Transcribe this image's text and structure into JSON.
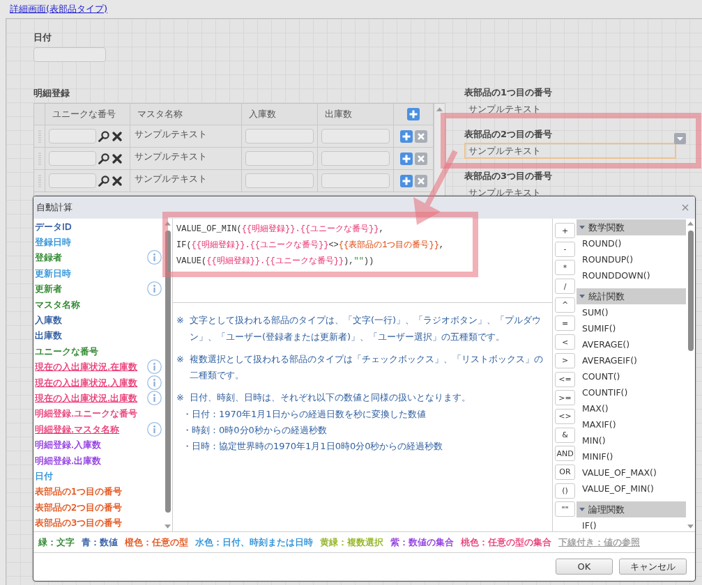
{
  "page_link": "詳細画面(表部品タイプ)",
  "date_field": {
    "label": "日付"
  },
  "detail_table": {
    "title": "明細登録",
    "columns": [
      "ユニークな番号",
      "マスタ名称",
      "入庫数",
      "出庫数"
    ],
    "rows": [
      {
        "master_name": "サンプルテキスト"
      },
      {
        "master_name": "サンプルテキスト"
      },
      {
        "master_name": "サンプルテキスト"
      }
    ]
  },
  "table_parts": [
    {
      "label": "表部品の1つ目の番号",
      "value": "サンプルテキスト",
      "selected": false
    },
    {
      "label": "表部品の2つ目の番号",
      "value": "サンプルテキスト",
      "selected": true
    },
    {
      "label": "表部品の3つ目の番号",
      "value": "サンプルテキスト",
      "selected": false
    }
  ],
  "dialog": {
    "title": "自動計算",
    "fields": [
      {
        "label": "データID",
        "color": "#1f4e99",
        "underlined": false,
        "info": false
      },
      {
        "label": "登録日時",
        "color": "#1f8ad6",
        "underlined": false,
        "info": false
      },
      {
        "label": "登録者",
        "color": "#1d7d1d",
        "underlined": false,
        "info": true
      },
      {
        "label": "更新日時",
        "color": "#1f8ad6",
        "underlined": false,
        "info": false
      },
      {
        "label": "更新者",
        "color": "#1d7d1d",
        "underlined": false,
        "info": true
      },
      {
        "label": "マスタ名称",
        "color": "#1d7d1d",
        "underlined": false,
        "info": false
      },
      {
        "label": "入庫数",
        "color": "#1f4e99",
        "underlined": false,
        "info": false
      },
      {
        "label": "出庫数",
        "color": "#1f4e99",
        "underlined": false,
        "info": false
      },
      {
        "label": "ユニークな番号",
        "color": "#1d7d1d",
        "underlined": false,
        "info": false
      },
      {
        "label": "現在の入出庫状況.在庫数",
        "color": "#e8336e",
        "underlined": true,
        "info": true
      },
      {
        "label": "現在の入出庫状況.入庫数",
        "color": "#e8336e",
        "underlined": true,
        "info": true
      },
      {
        "label": "現在の入出庫状況.出庫数",
        "color": "#e8336e",
        "underlined": true,
        "info": true
      },
      {
        "label": "明細登録.ユニークな番号",
        "color": "#e8336e",
        "underlined": false,
        "info": false
      },
      {
        "label": "明細登録.マスタ名称",
        "color": "#e8336e",
        "underlined": true,
        "info": true
      },
      {
        "label": "明細登録.入庫数",
        "color": "#8b2fe0",
        "underlined": false,
        "info": false
      },
      {
        "label": "明細登録.出庫数",
        "color": "#8b2fe0",
        "underlined": false,
        "info": false
      },
      {
        "label": "日付",
        "color": "#1f8ad6",
        "underlined": false,
        "info": false
      },
      {
        "label": "表部品の1つ目の番号",
        "color": "#e0480c",
        "underlined": false,
        "info": false
      },
      {
        "label": "表部品の2つ目の番号",
        "color": "#e0480c",
        "underlined": false,
        "info": false
      },
      {
        "label": "表部品の3つ目の番号",
        "color": "#e0480c",
        "underlined": false,
        "info": false
      }
    ],
    "formula": [
      {
        "tokens": [
          {
            "text": "VALUE_OF_MIN("
          },
          {
            "text": "{{明細登録}}.{{ユニークな番号}}",
            "color": "#e8336e"
          },
          {
            "text": ","
          }
        ]
      },
      {
        "tokens": [
          {
            "text": "IF("
          },
          {
            "text": "{{明細登録}}.{{ユニークな番号}}",
            "color": "#e8336e"
          },
          {
            "text": "<>"
          },
          {
            "text": "{{表部品の1つ目の番号}}",
            "color": "#e0480c"
          },
          {
            "text": ","
          }
        ]
      },
      {
        "tokens": [
          {
            "text": "VALUE("
          },
          {
            "text": "{{明細登録}}.{{ユニークな番号}}",
            "color": "#e8336e"
          },
          {
            "text": "),"
          },
          {
            "text": "\"\"",
            "color": "#3a9a3a"
          },
          {
            "text": "))"
          }
        ]
      }
    ],
    "notes": [
      {
        "mark": "※",
        "text": "文字として扱われる部品のタイプは、「文字(一行)」、「ラジオボタン」、「プルダウン」、「ユーザー(登録者または更新者)」、「ユーザー選択」の五種類です。"
      },
      {
        "mark": "※",
        "text": "複数選択として扱われる部品のタイプは「チェックボックス」、「リストボックス」の二種類です。"
      },
      {
        "mark": "※",
        "text": "日付、時刻、日時は、それぞれ以下の数値と同様の扱いとなります。",
        "items": [
          "・日付：1970年1月1日からの経過日数を秒に変換した数値",
          "・時刻：0時0分0秒からの経過秒数",
          "・日時：協定世界時の1970年1月1日0時0分0秒からの経過秒数"
        ]
      }
    ],
    "operators": [
      "+",
      "-",
      "*",
      "/",
      "^",
      "=",
      "<",
      ">",
      "<=",
      ">=",
      "<>",
      "&",
      "AND",
      "OR",
      "()",
      "\"\""
    ],
    "function_groups": [
      {
        "title": "数学関数",
        "expanded": true,
        "items": [
          "ROUND()",
          "ROUNDUP()",
          "ROUNDDOWN()"
        ]
      },
      {
        "title": "統計関数",
        "expanded": true,
        "items": [
          "SUM()",
          "SUMIF()",
          "AVERAGE()",
          "AVERAGEIF()",
          "COUNT()",
          "COUNTIF()",
          "MAX()",
          "MAXIF()",
          "MIN()",
          "MINIF()",
          "VALUE_OF_MAX()",
          "VALUE_OF_MIN()"
        ]
      },
      {
        "title": "論理関数",
        "expanded": true,
        "items": [
          "IF()"
        ]
      }
    ],
    "legend": [
      {
        "text": "緑：文字",
        "color": "#1d7d1d",
        "underlined": false
      },
      {
        "text": "青：数値",
        "color": "#1f4e99",
        "underlined": false
      },
      {
        "text": "橙色：任意の型",
        "color": "#e0480c",
        "underlined": false
      },
      {
        "text": "水色：日付、時刻または日時",
        "color": "#1f8ad6",
        "underlined": false
      },
      {
        "text": "黄緑：複数選択",
        "color": "#8aae12",
        "underlined": false
      },
      {
        "text": "紫：数値の集合",
        "color": "#8b2fe0",
        "underlined": false
      },
      {
        "text": "桃色：任意の型の集合",
        "color": "#e8336e",
        "underlined": false
      },
      {
        "text": "下線付き：値の参照",
        "color": "#999999",
        "underlined": true
      }
    ],
    "buttons": [
      "OK",
      "キャンセル"
    ]
  }
}
